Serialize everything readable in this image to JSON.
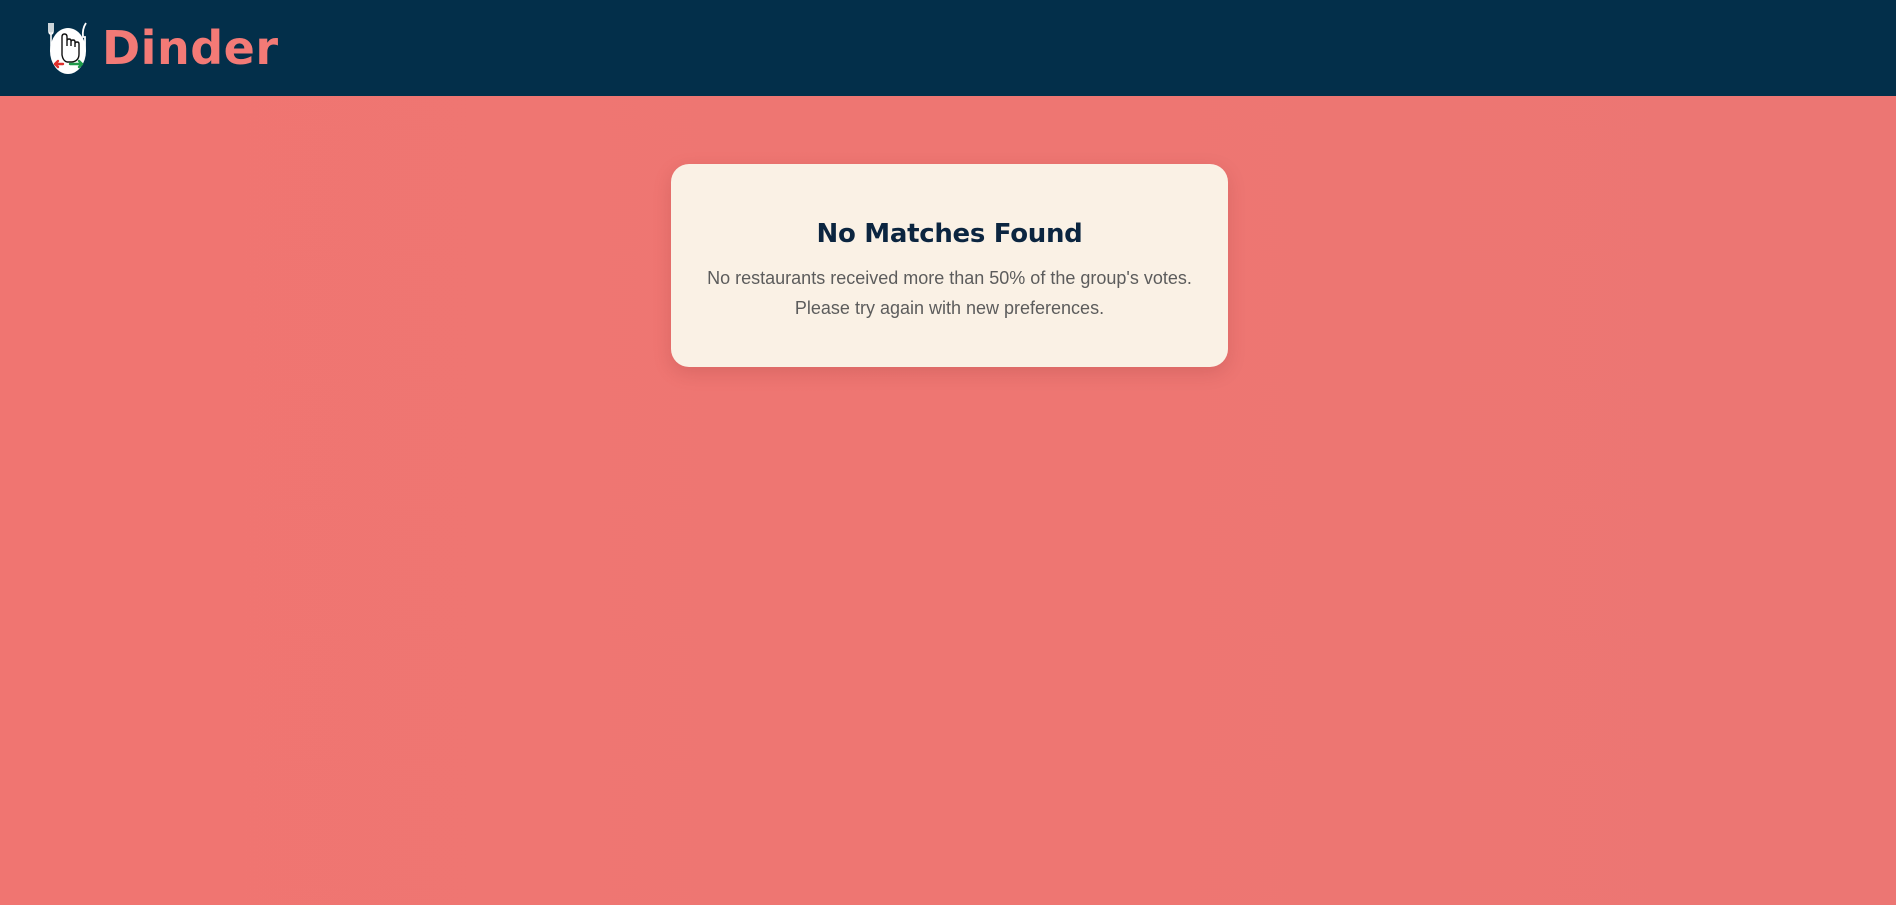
{
  "navbar": {
    "brand_name": "Dinder",
    "logo_icon": "hand-swipe-utensils-logo-icon",
    "background_color": "#032f4a",
    "brand_color": "#f37a76"
  },
  "main": {
    "background_color": "#ee7672"
  },
  "result_card": {
    "title": "No Matches Found",
    "message_line_1": "No restaurants received more than 50% of the group's votes.",
    "message_line_2": "Please try again with new preferences.",
    "background_color": "#faf1e5",
    "title_color": "#0b2540"
  }
}
